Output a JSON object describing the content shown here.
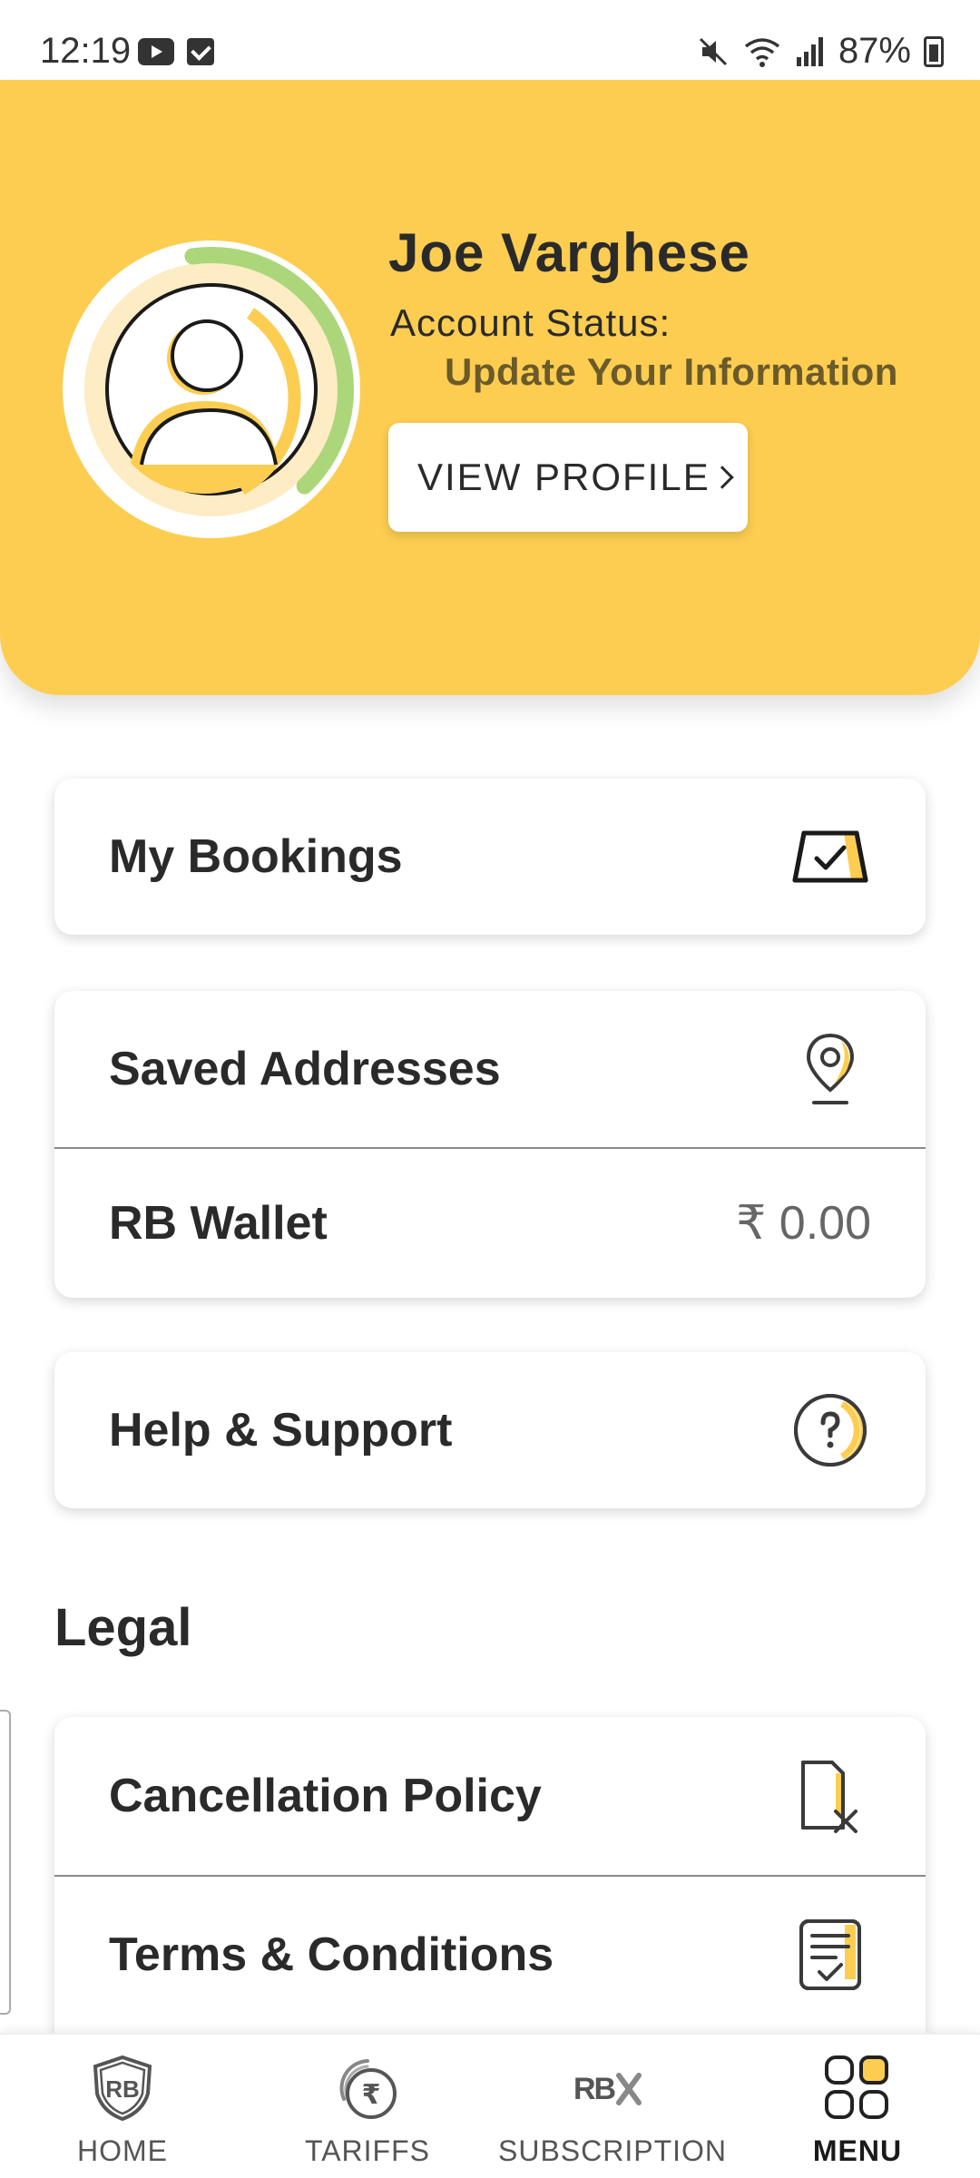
{
  "status_bar": {
    "time": "12:19",
    "battery": "87%"
  },
  "profile": {
    "name": "Joe Varghese",
    "account_status_label": "Account Status:",
    "account_status_value": "Update Your Information",
    "view_profile_label": "VIEW PROFILE",
    "completion_fraction": 0.4
  },
  "menu": {
    "my_bookings": "My Bookings",
    "saved_addresses": "Saved Addresses",
    "rb_wallet": "RB Wallet",
    "rb_wallet_value": "₹ 0.00",
    "help_support": "Help & Support"
  },
  "legal": {
    "title": "Legal",
    "cancellation_policy": "Cancellation Policy",
    "terms_conditions": "Terms & Conditions"
  },
  "bottom_nav": {
    "items": [
      {
        "label": "HOME",
        "icon": "rb-shield-icon"
      },
      {
        "label": "TARIFFS",
        "icon": "rupee-icon"
      },
      {
        "label": "SUBSCRIPTION",
        "icon": "rbx-icon"
      },
      {
        "label": "MENU",
        "icon": "grid-icon"
      }
    ],
    "active": "MENU"
  },
  "colors": {
    "brand_yellow": "#fccd51",
    "progress_green": "#acd67a"
  }
}
